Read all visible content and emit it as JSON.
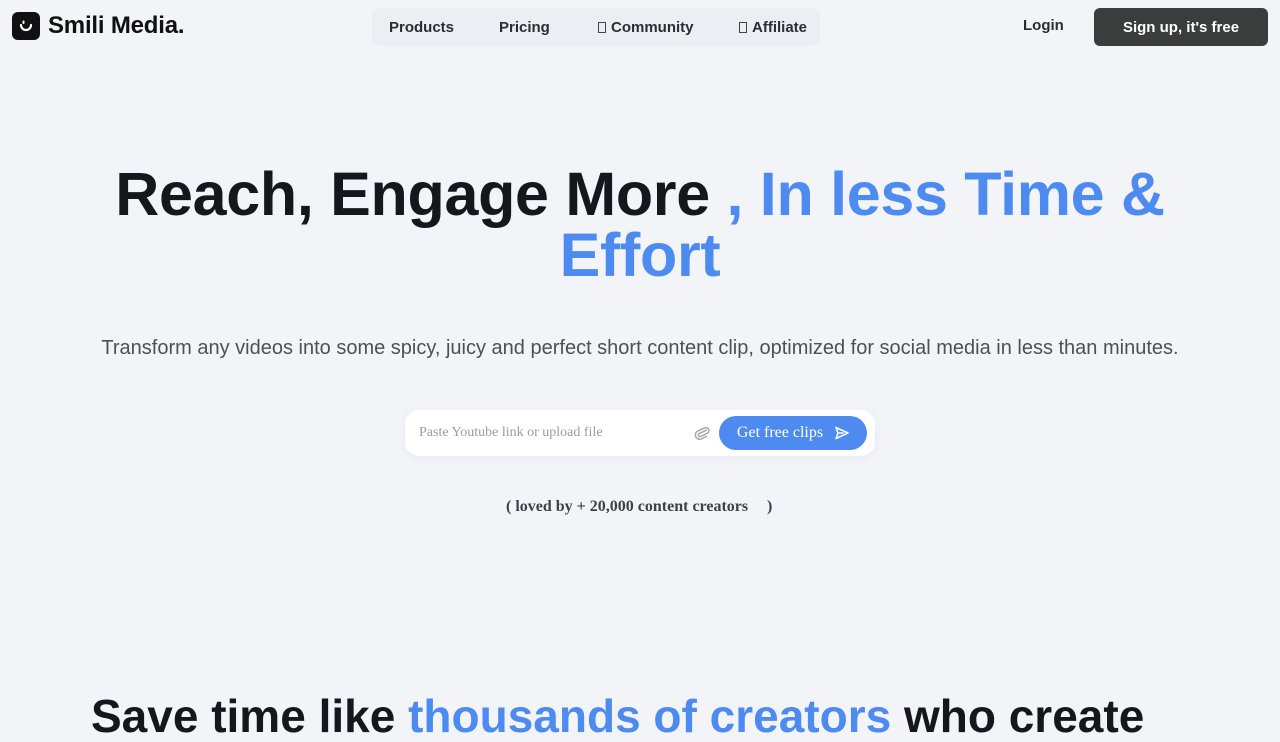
{
  "brand": {
    "name": "Smili Media.",
    "logo_icon": "smile-logo-icon"
  },
  "nav": {
    "items": [
      {
        "label": "Products",
        "icon": ""
      },
      {
        "label": "Pricing",
        "icon": ""
      },
      {
        "label": "Community",
        "icon": "missing-glyph-icon"
      },
      {
        "label": "Affiliate",
        "icon": "missing-glyph-icon"
      }
    ],
    "login_label": "Login",
    "signup_label": "Sign up, it's free"
  },
  "hero": {
    "title_part1": "Reach, Engage More",
    "title_part2": ", In less Time &",
    "title_part3": "Effort",
    "subtitle": "Transform any videos into some spicy, juicy and perfect short content clip, optimized for social media in less than minutes.",
    "input_placeholder": "Paste Youtube link or upload file",
    "input_value": "",
    "attach_icon": "paperclip-icon",
    "cta_label": "Get free clips",
    "cta_icon": "send-icon",
    "loved_text": "( loved by + 20,000 content creators",
    "loved_close": ")"
  },
  "section2": {
    "title_part1": "Save time like ",
    "title_part2": "thousands of creators",
    "title_part3": " who create"
  },
  "colors": {
    "background": "#f2f4f8",
    "accent": "#4d8bf0",
    "dark_button": "#3b3d3c",
    "text": "#15171c"
  }
}
